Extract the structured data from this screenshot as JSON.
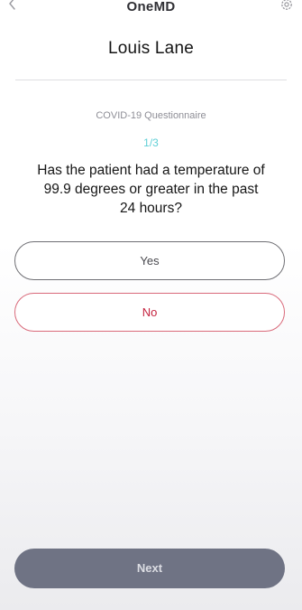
{
  "header": {
    "app_title": "OneMD",
    "back_icon": "chevron-left-icon",
    "settings_icon": "gear-icon"
  },
  "patient": {
    "name": "Louis Lane"
  },
  "questionnaire": {
    "title": "COVID-19 Questionnaire",
    "progress": "1/3",
    "question": "Has the patient had a temperature of 99.9 degrees or greater in the past 24 hours?"
  },
  "answers": {
    "yes_label": "Yes",
    "no_label": "No"
  },
  "footer": {
    "next_label": "Next"
  },
  "colors": {
    "accent": "#5fcfd6",
    "no_button": "#c5233f",
    "next_button_bg": "#6f7384"
  }
}
